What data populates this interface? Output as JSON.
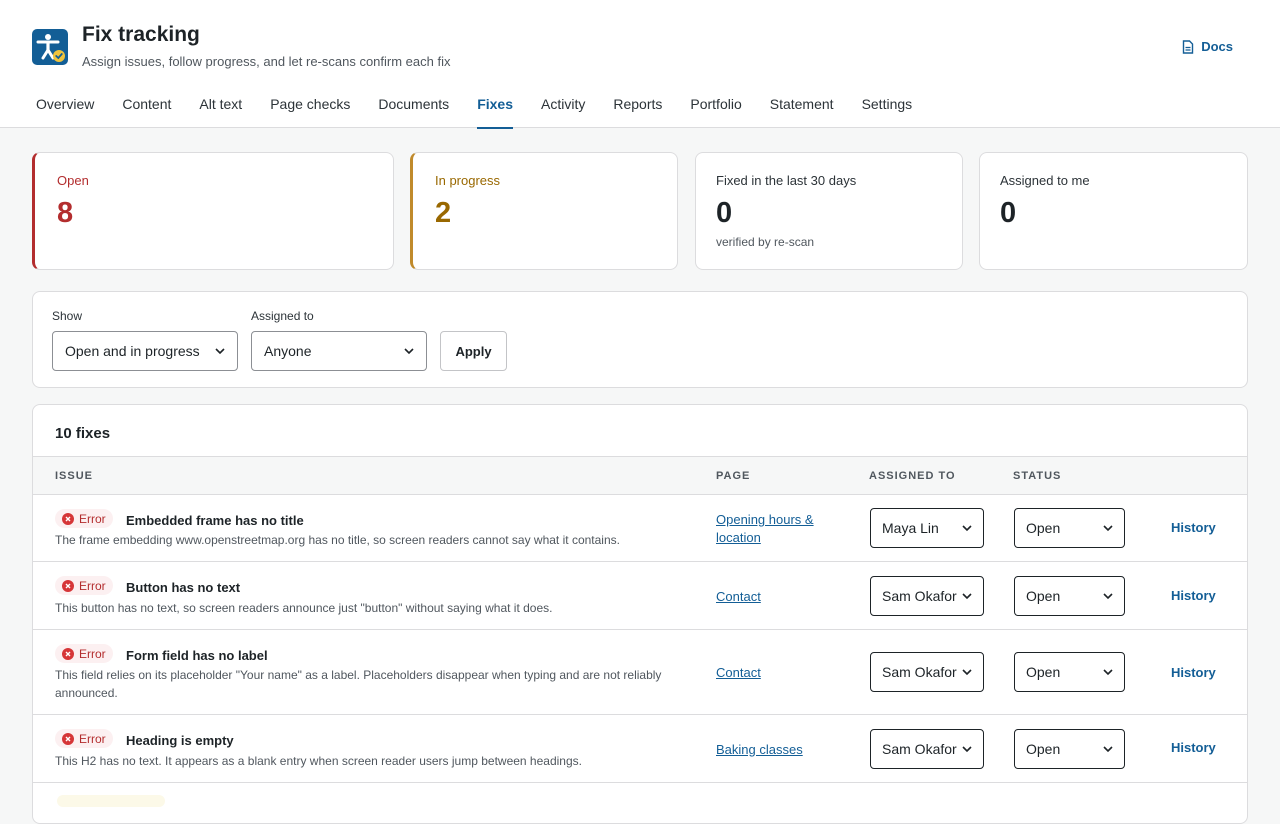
{
  "header": {
    "title": "Fix tracking",
    "subtitle": "Assign issues, follow progress, and let re-scans confirm each fix",
    "docs_label": "Docs",
    "app_icon": "accessibility-icon",
    "brand_color": "#135e96"
  },
  "tabs": [
    {
      "label": "Overview"
    },
    {
      "label": "Content"
    },
    {
      "label": "Alt text"
    },
    {
      "label": "Page checks"
    },
    {
      "label": "Documents"
    },
    {
      "label": "Fixes",
      "active": true
    },
    {
      "label": "Activity"
    },
    {
      "label": "Reports"
    },
    {
      "label": "Portfolio"
    },
    {
      "label": "Statement"
    },
    {
      "label": "Settings"
    }
  ],
  "stats": {
    "open": {
      "label": "Open",
      "value": "8",
      "color": "#b32d2e"
    },
    "in_progress": {
      "label": "In progress",
      "value": "2",
      "color": "#996800"
    },
    "fixed": {
      "label": "Fixed in the last 30 days",
      "value": "0",
      "note": "verified by re-scan"
    },
    "assigned": {
      "label": "Assigned to me",
      "value": "0"
    }
  },
  "filters": {
    "show_label": "Show",
    "show_value": "Open and in progress",
    "assigned_label": "Assigned to",
    "assigned_value": "Anyone",
    "apply_label": "Apply"
  },
  "fixes": {
    "count_label": "10 fixes",
    "columns": {
      "issue": "ISSUE",
      "page": "PAGE",
      "assigned": "ASSIGNED TO",
      "status": "STATUS"
    },
    "rows": [
      {
        "severity": "Error",
        "title": "Embedded frame has no title",
        "description": "The frame embedding www.openstreetmap.org has no title, so screen readers cannot say what it contains.",
        "page": "Opening hours & location",
        "assignee": "Maya Lin",
        "status": "Open",
        "history_label": "History"
      },
      {
        "severity": "Error",
        "title": "Button has no text",
        "description": "This button has no text, so screen readers announce just \"button\" without saying what it does.",
        "page": "Contact",
        "assignee": "Sam Okafor",
        "status": "Open",
        "history_label": "History"
      },
      {
        "severity": "Error",
        "title": "Form field has no label",
        "description": "This field relies on its placeholder \"Your name\" as a label. Placeholders disappear when typing and are not reliably announced.",
        "page": "Contact",
        "assignee": "Sam Okafor",
        "status": "Open",
        "history_label": "History"
      },
      {
        "severity": "Error",
        "title": "Heading is empty",
        "description": "This H2 has no text. It appears as a blank entry when screen reader users jump between headings.",
        "page": "Baking classes",
        "assignee": "Sam Okafor",
        "status": "Open",
        "history_label": "History"
      }
    ]
  }
}
